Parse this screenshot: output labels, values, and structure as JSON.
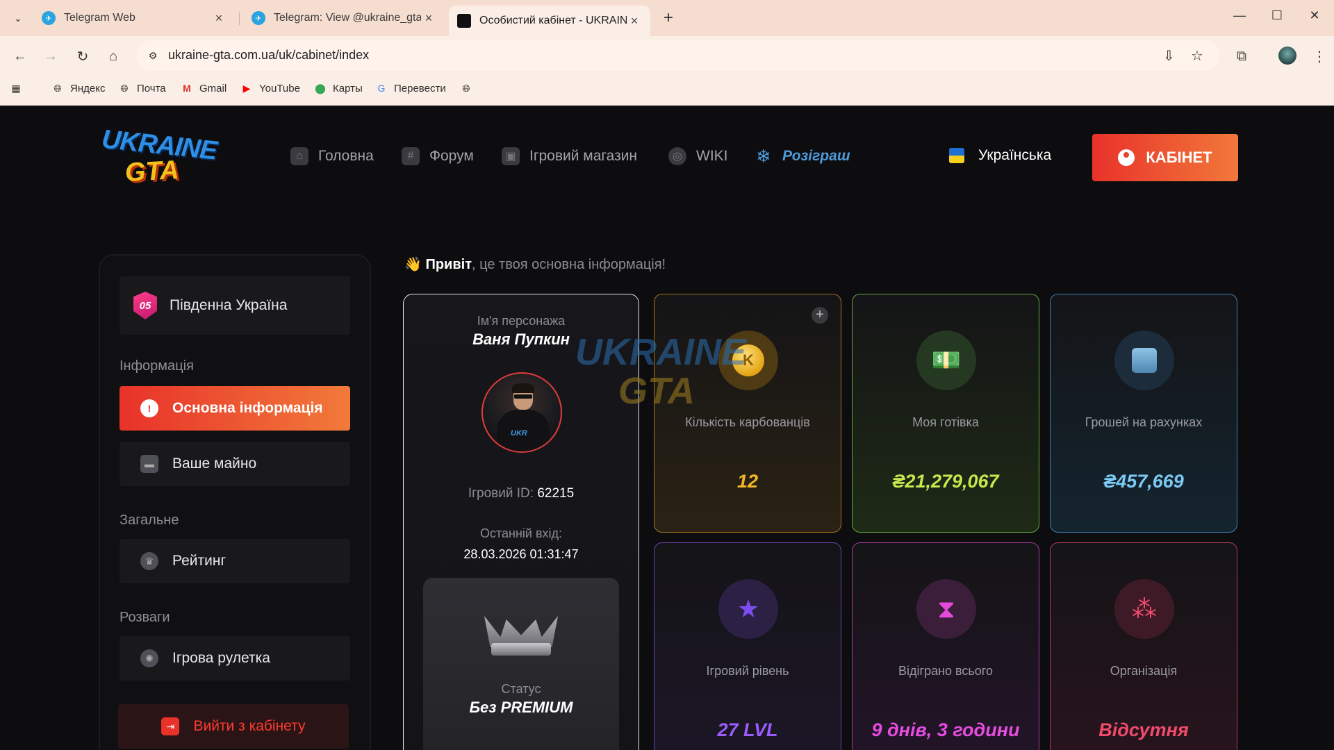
{
  "browser": {
    "tabs": [
      {
        "title": "Telegram Web"
      },
      {
        "title": "Telegram: View @ukraine_gta"
      },
      {
        "title": "Особистий кабінет - UKRAINE"
      }
    ],
    "url": "ukraine-gta.com.ua/uk/cabinet/index",
    "bookmarks": [
      {
        "label": "Яндекс"
      },
      {
        "label": "Почта"
      },
      {
        "label": "Gmail"
      },
      {
        "label": "YouTube"
      },
      {
        "label": "Карты"
      },
      {
        "label": "Перевести"
      }
    ]
  },
  "site": {
    "logo": {
      "line1": "UKRAINE",
      "line2": "GTA"
    },
    "nav": [
      {
        "label": "Головна"
      },
      {
        "label": "Форум"
      },
      {
        "label": "Ігровий магазин"
      },
      {
        "label": "WIKI"
      },
      {
        "label": "Розіграш"
      }
    ],
    "language": "Українська",
    "cabinet_button": "КАБІНЕТ",
    "accent_colors": {
      "primary": "#e8322a",
      "secondary": "#f27a3a"
    }
  },
  "sidebar": {
    "server": {
      "badge": "05",
      "name": "Південна Україна"
    },
    "sections": [
      {
        "title": "Інформація",
        "items": [
          {
            "label": "Основна інформація",
            "active": true,
            "icon": "alert-icon"
          },
          {
            "label": "Ваше майно",
            "active": false,
            "icon": "car-icon"
          }
        ]
      },
      {
        "title": "Загальне",
        "items": [
          {
            "label": "Рейтинг",
            "active": false,
            "icon": "trophy-icon"
          }
        ]
      },
      {
        "title": "Розваги",
        "items": [
          {
            "label": "Ігрова рулетка",
            "active": false,
            "icon": "roulette-icon"
          }
        ]
      }
    ],
    "exit": "Вийти з кабінету"
  },
  "main": {
    "greeting_bold": "Привіт",
    "greeting_rest": ", це твоя основна інформація!",
    "character": {
      "name_label": "Ім'я персонажа",
      "name": "Ваня Пупкин",
      "id_label": "Ігровий ID:",
      "id": "62215",
      "last_login_label": "Останній вхід:",
      "last_login": "28.03.2026 01:31:47",
      "status_label": "Статус",
      "status": "Без PREMIUM"
    },
    "stats": [
      {
        "label": "Кількість карбованців",
        "value": "12"
      },
      {
        "label": "Моя готівка",
        "value": "₴21,279,067"
      },
      {
        "label": "Грошей на рахунках",
        "value": "₴457,669"
      },
      {
        "label": "Ігровий рівень",
        "value": "27 LVL"
      },
      {
        "label": "Відіграно всього",
        "value": "9 днів, 3 години"
      },
      {
        "label": "Організація",
        "value": "Відсутня"
      }
    ]
  }
}
